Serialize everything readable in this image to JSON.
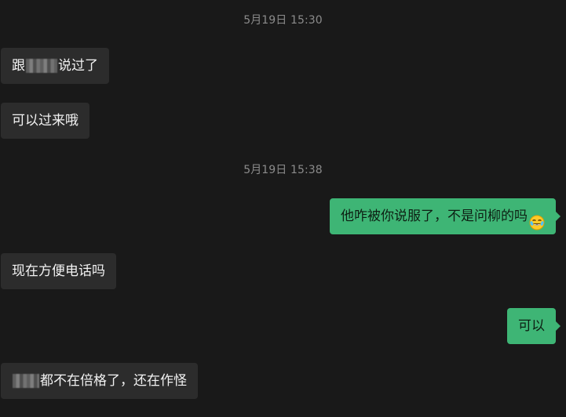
{
  "timestamps": [
    "5月19日 15:30",
    "5月19日 15:38"
  ],
  "messages": {
    "m1": {
      "before": "跟",
      "after": "说过了"
    },
    "m2": {
      "text": "可以过来哦"
    },
    "m3": {
      "text": "他咋被你说服了，不是问柳的吗",
      "emoji": "laughing-crying-face"
    },
    "m4": {
      "text": "现在方便电话吗"
    },
    "m5": {
      "text": "可以"
    },
    "m6": {
      "after": "都不在倍格了，还在作怪"
    }
  },
  "colors": {
    "background": "#191919",
    "incoming_bubble": "#2c2c2c",
    "outgoing_bubble": "#3eb575",
    "timestamp": "#8b8b8b"
  }
}
